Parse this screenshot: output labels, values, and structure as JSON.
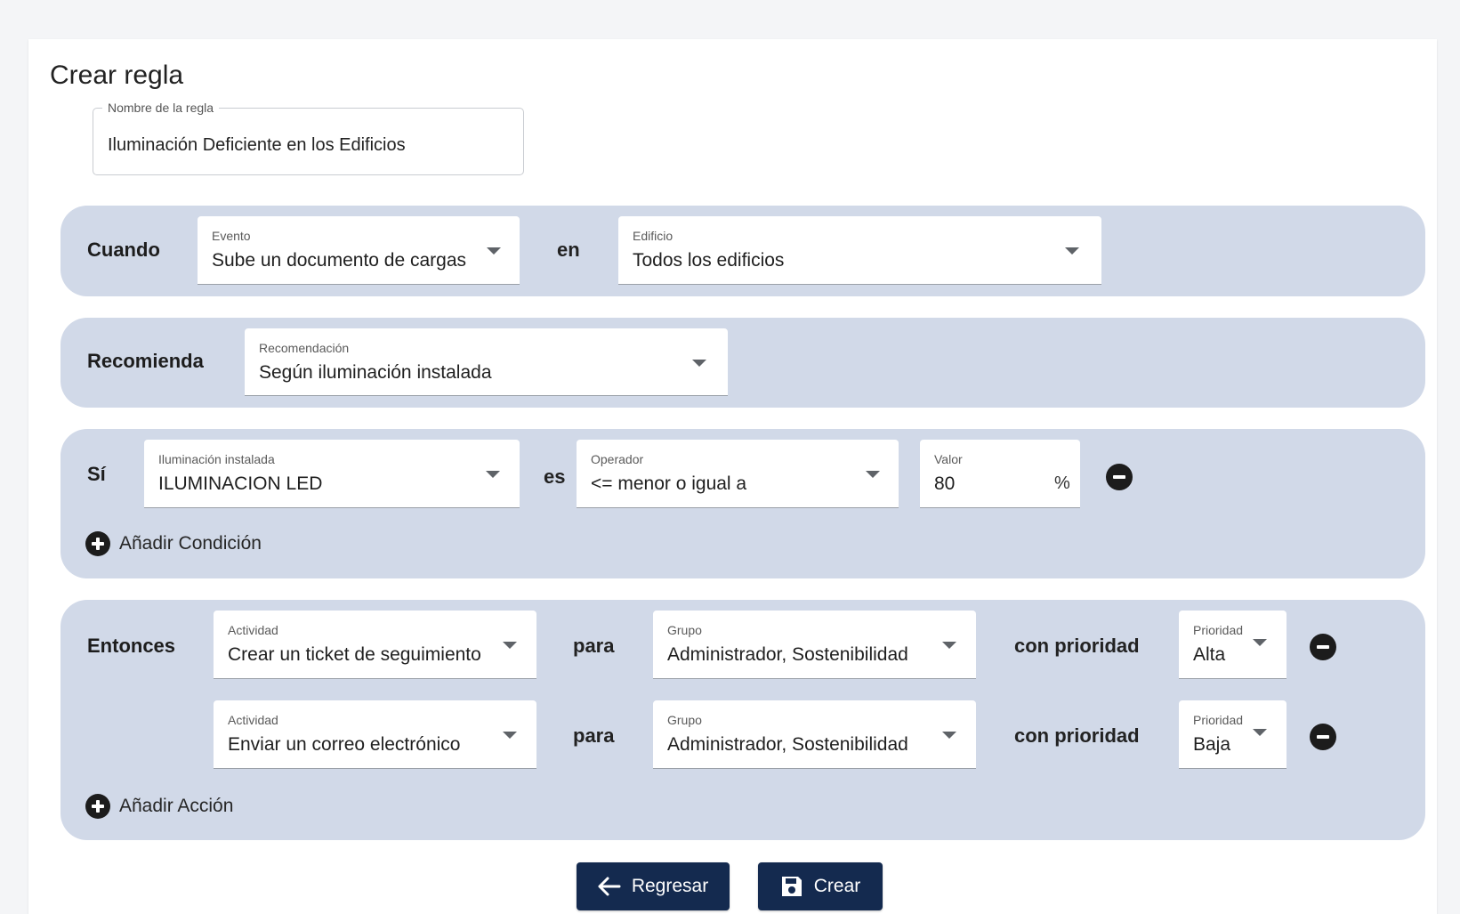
{
  "form": {
    "title": "Crear regla",
    "name_field": {
      "label": "Nombre de la regla",
      "value": "Iluminación Deficiente en los Edificios"
    }
  },
  "when": {
    "label": "Cuando",
    "event": {
      "label": "Evento",
      "value": "Sube un documento de cargas"
    },
    "connector": "en",
    "building": {
      "label": "Edificio",
      "value": "Todos los edificios"
    }
  },
  "recommend": {
    "label": "Recomienda",
    "recommendation": {
      "label": "Recomendación",
      "value": "Según iluminación instalada"
    }
  },
  "if": {
    "label": "Sí",
    "conditions": [
      {
        "lighting": {
          "label": "Iluminación instalada",
          "value": "ILUMINACION LED"
        },
        "connector": "es",
        "operator": {
          "label": "Operador",
          "value": "<= menor o igual a"
        },
        "value": {
          "label": "Valor",
          "value": "80",
          "suffix": "%"
        }
      }
    ],
    "add_label": "Añadir Condición"
  },
  "then": {
    "label": "Entonces",
    "actions": [
      {
        "activity": {
          "label": "Actividad",
          "value": "Crear un ticket de seguimiento"
        },
        "connector": "para",
        "group": {
          "label": "Grupo",
          "value": "Administrador, Sostenibilidad"
        },
        "priority_connector": "con prioridad",
        "priority": {
          "label": "Prioridad",
          "value": "Alta"
        }
      },
      {
        "activity": {
          "label": "Actividad",
          "value": "Enviar un correo electrónico"
        },
        "connector": "para",
        "group": {
          "label": "Grupo",
          "value": "Administrador, Sostenibilidad"
        },
        "priority_connector": "con prioridad",
        "priority": {
          "label": "Prioridad",
          "value": "Baja"
        }
      }
    ],
    "add_label": "Añadir Acción"
  },
  "buttons": {
    "back": "Regresar",
    "create": "Crear"
  },
  "colors": {
    "band": "#d1d9e8",
    "button": "#142a4f",
    "icon_dark": "#1c1c1c"
  },
  "icons": [
    "arrow-left-icon",
    "save-icon",
    "plus-circle-icon",
    "minus-circle-icon",
    "dropdown-caret-icon"
  ]
}
